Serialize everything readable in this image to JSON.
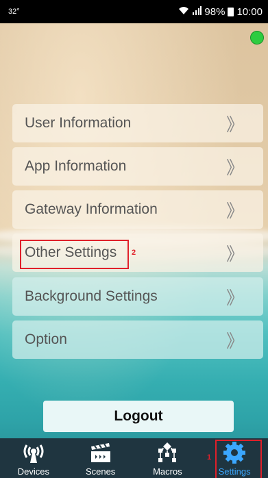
{
  "status_bar": {
    "temperature": "32°",
    "battery": "98%",
    "time": "10:00"
  },
  "menu": [
    {
      "label": "User Information"
    },
    {
      "label": "App Information"
    },
    {
      "label": "Gateway Information"
    },
    {
      "label": "Other Settings"
    },
    {
      "label": "Background Settings"
    },
    {
      "label": "Option"
    }
  ],
  "chevron": "》",
  "logout_label": "Logout",
  "annotations": {
    "settings_number": "1",
    "other_settings_number": "2"
  },
  "tabs": [
    {
      "label": "Devices",
      "icon": "radio-signal-icon"
    },
    {
      "label": "Scenes",
      "icon": "clapperboard-icon"
    },
    {
      "label": "Macros",
      "icon": "flowchart-icon"
    },
    {
      "label": "Settings",
      "icon": "gear-icon"
    }
  ],
  "colors": {
    "online": "#2ecc40",
    "active_tab": "#3ba7ff",
    "annotation": "#e0202a"
  }
}
